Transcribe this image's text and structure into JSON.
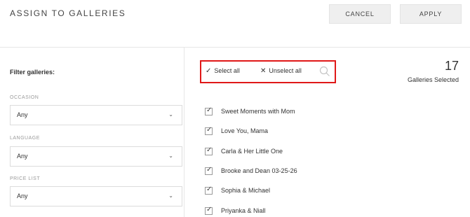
{
  "header": {
    "title": "ASSIGN TO GALLERIES",
    "cancel_label": "CANCEL",
    "apply_label": "APPLY"
  },
  "sidebar": {
    "filter_title": "Filter galleries:",
    "filters": [
      {
        "label": "OCCASION",
        "value": "Any"
      },
      {
        "label": "LANGUAGE",
        "value": "Any"
      },
      {
        "label": "PRICE LIST",
        "value": "Any"
      }
    ]
  },
  "toolbar": {
    "select_all_icon": "✓",
    "select_all": "Select all",
    "unselect_all_icon": "✕",
    "unselect_all": "Unselect all",
    "search_icon": "search-icon",
    "highlight_color": "#e01818"
  },
  "summary": {
    "count": "17",
    "label": "Galleries Selected"
  },
  "galleries": [
    {
      "name": "Sweet Moments with Mom",
      "checked": true
    },
    {
      "name": "Love You, Mama",
      "checked": true
    },
    {
      "name": "Carla & Her Little One",
      "checked": true
    },
    {
      "name": "Brooke and Dean 03-25-26",
      "checked": true
    },
    {
      "name": "Sophia & Michael",
      "checked": true
    },
    {
      "name": "Priyanka & Niall",
      "checked": true
    }
  ]
}
